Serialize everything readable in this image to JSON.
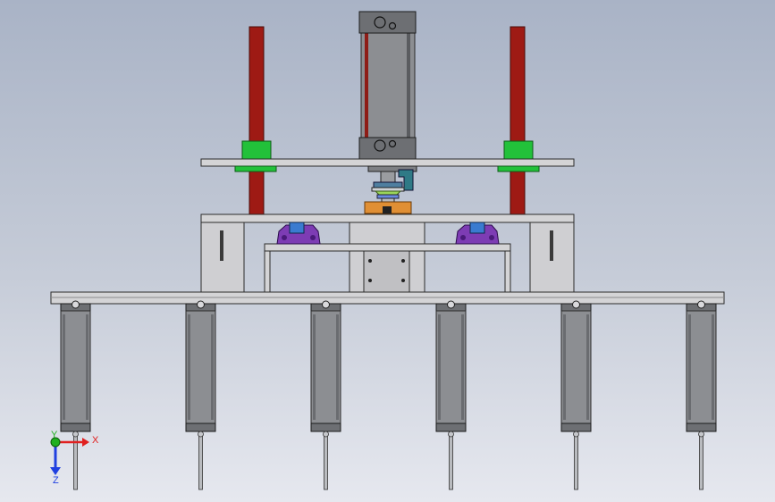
{
  "viewport": {
    "background_top": "#a9b3c6",
    "background_bottom": "#e6e8ef"
  },
  "model": {
    "guide_rod_color": "#9e1a14",
    "bushing_color": "#22c13a",
    "cylinder_color": "#8a8c90",
    "nest_color": "#e08f34",
    "clamp_color": "#7d3cb4",
    "frame_color": "#d4d4d6",
    "edge_color": "#2b2b2b",
    "lower_cylinder_count": 6
  },
  "triad": {
    "x_label": "X",
    "y_label": "Y",
    "z_label": "Z",
    "x_color": "#e02020",
    "y_color": "#20b020",
    "z_color": "#2040e0"
  }
}
